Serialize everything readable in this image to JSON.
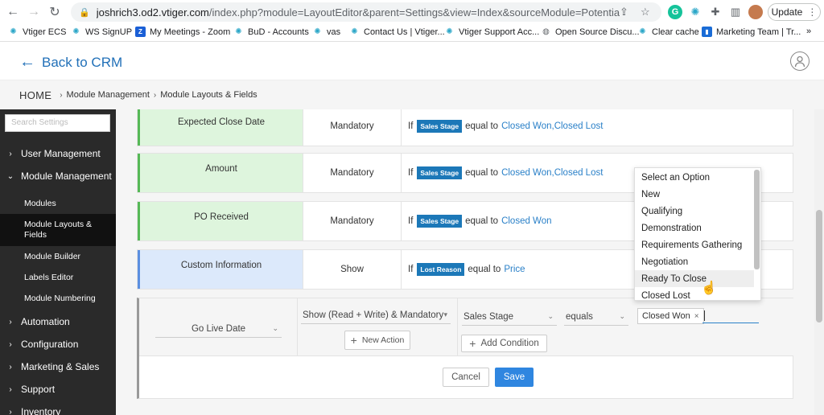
{
  "browser": {
    "url_host": "joshrich3.od2.vtiger.com",
    "url_path": "/index.php?module=LayoutEditor&parent=Settings&view=Index&sourceModule=Potentials&mode=sho...",
    "update_label": "Update",
    "bookmarks": [
      {
        "label": "Vtiger ECS",
        "icon": "vtiger-icon"
      },
      {
        "label": "WS SignUP",
        "icon": "vtiger-icon"
      },
      {
        "label": "My Meetings - Zoom",
        "icon": "zoom-icon"
      },
      {
        "label": "BuD - Accounts",
        "icon": "vtiger-icon"
      },
      {
        "label": "vas",
        "icon": "vtiger-icon"
      },
      {
        "label": "Contact Us | Vtiger...",
        "icon": "vtiger-icon"
      },
      {
        "label": "Vtiger Support Acc...",
        "icon": "vtiger-icon"
      },
      {
        "label": "Open Source Discu...",
        "icon": "globe-icon"
      },
      {
        "label": "Clear cache",
        "icon": "vtiger-icon"
      },
      {
        "label": "Marketing Team | Tr...",
        "icon": "trello-icon"
      }
    ],
    "bookmarks_more": "»"
  },
  "header": {
    "back_label": "Back to CRM"
  },
  "breadcrumb": {
    "home": "HOME",
    "items": [
      "Module Management",
      "Module Layouts & Fields"
    ]
  },
  "sidebar": {
    "search_placeholder": "Search Settings",
    "items": [
      {
        "label": "User Management",
        "chevron": "›"
      },
      {
        "label": "Module Management",
        "chevron": "⌄"
      },
      {
        "label": "Automation",
        "chevron": "›"
      },
      {
        "label": "Configuration",
        "chevron": "›"
      },
      {
        "label": "Marketing & Sales",
        "chevron": "›"
      },
      {
        "label": "Support",
        "chevron": "›"
      },
      {
        "label": "Inventory",
        "chevron": "›"
      }
    ],
    "sub_items": [
      "Modules",
      "Module Layouts & Fields",
      "Module Builder",
      "Labels Editor",
      "Module Numbering"
    ]
  },
  "rules": [
    {
      "field": "Expected Close Date",
      "action": "Mandatory",
      "if": "If",
      "tag": "Sales Stage",
      "op": "equal to",
      "value": "Closed Won,Closed Lost"
    },
    {
      "field": "Amount",
      "action": "Mandatory",
      "if": "If",
      "tag": "Sales Stage",
      "op": "equal to",
      "value": "Closed Won,Closed Lost"
    },
    {
      "field": "PO Received",
      "action": "Mandatory",
      "if": "If",
      "tag": "Sales Stage",
      "op": "equal to",
      "value": "Closed Won"
    },
    {
      "field": "Custom Information",
      "action": "Show",
      "if": "If",
      "tag": "Lost Reason",
      "op": "equal to",
      "value": "Price"
    }
  ],
  "editor": {
    "field": "Go Live Date",
    "action": "Show (Read + Write) & Mandatory",
    "new_action_label": "New Action",
    "condition_field": "Sales Stage",
    "condition_op": "equals",
    "chip_value": "Closed Won",
    "chip_remove": "×",
    "add_condition_label": "Add Condition",
    "cancel_label": "Cancel",
    "save_label": "Save"
  },
  "dropdown": {
    "options": [
      "Select an Option",
      "New",
      "Qualifying",
      "Demonstration",
      "Requirements Gathering",
      "Negotiation",
      "Ready To Close",
      "Closed Lost"
    ],
    "hovered": "Ready To Close"
  },
  "colors": {
    "accent": "#2170b8",
    "tag": "#1c78b8",
    "save": "#2f86e0",
    "sidebar": "#2a2a2a",
    "green_field": "#def5dd",
    "blue_field": "#dce9fb"
  }
}
